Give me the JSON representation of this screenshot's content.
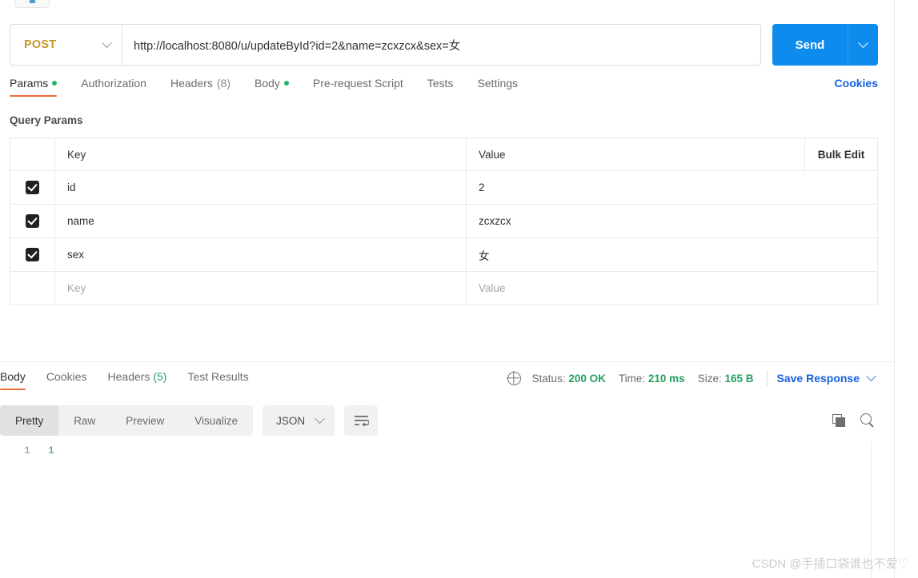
{
  "request": {
    "method": "POST",
    "url": "http://localhost:8080/u/updateById?id=2&name=zcxzcx&sex=女",
    "send_label": "Send",
    "tabs": [
      {
        "label": "Params",
        "dot": true,
        "count": "",
        "active": true
      },
      {
        "label": "Authorization",
        "dot": false,
        "count": "",
        "active": false
      },
      {
        "label": "Headers",
        "dot": false,
        "count": "(8)",
        "active": false
      },
      {
        "label": "Body",
        "dot": true,
        "count": "",
        "active": false
      },
      {
        "label": "Pre-request Script",
        "dot": false,
        "count": "",
        "active": false
      },
      {
        "label": "Tests",
        "dot": false,
        "count": "",
        "active": false
      },
      {
        "label": "Settings",
        "dot": false,
        "count": "",
        "active": false
      }
    ],
    "cookies_link": "Cookies"
  },
  "query_params": {
    "title": "Query Params",
    "columns": {
      "key": "Key",
      "value": "Value",
      "bulk_edit": "Bulk Edit"
    },
    "rows": [
      {
        "checked": true,
        "key": "id",
        "value": "2"
      },
      {
        "checked": true,
        "key": "name",
        "value": "zcxzcx"
      },
      {
        "checked": true,
        "key": "sex",
        "value": "女"
      }
    ],
    "placeholder_row": {
      "key": "Key",
      "value": "Value"
    }
  },
  "response": {
    "tabs": [
      {
        "label": "Body",
        "count": "",
        "active": true
      },
      {
        "label": "Cookies",
        "count": "",
        "active": false
      },
      {
        "label": "Headers",
        "count": "(5)",
        "active": false
      },
      {
        "label": "Test Results",
        "count": "",
        "active": false
      }
    ],
    "meta": {
      "status_label": "Status:",
      "status_value": "200 OK",
      "time_label": "Time:",
      "time_value": "210 ms",
      "size_label": "Size:",
      "size_value": "165 B",
      "save_label": "Save Response"
    },
    "format_tabs": [
      {
        "label": "Pretty",
        "active": true
      },
      {
        "label": "Raw",
        "active": false
      },
      {
        "label": "Preview",
        "active": false
      },
      {
        "label": "Visualize",
        "active": false
      }
    ],
    "language": "JSON",
    "body_lines": [
      {
        "num": "1",
        "text": "1"
      }
    ]
  },
  "watermark": "CSDN @手插口袋谁也不爱♡",
  "colors": {
    "accent_orange": "#ef6c37",
    "send_blue": "#0d8ced",
    "link_blue": "#1662e0",
    "method_amber": "#c5972c",
    "status_green": "#25a05e",
    "dot_green": "#25b06a"
  }
}
